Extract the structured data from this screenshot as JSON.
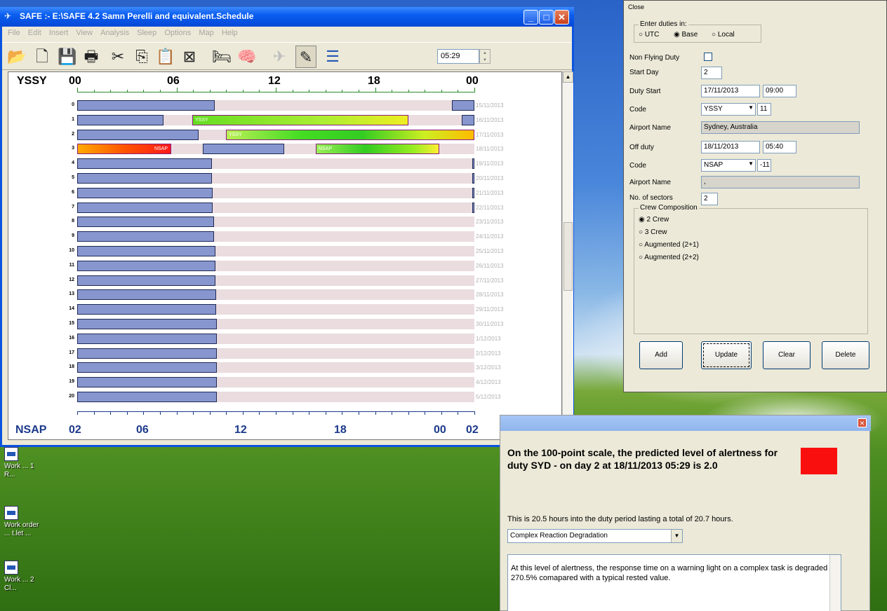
{
  "main_window": {
    "title": "SAFE :- E:\\SAFE 4.2 Samn Perelli and equivalent.Schedule",
    "menu": [
      "File",
      "Edit",
      "Insert",
      "View",
      "Analysis",
      "Sleep",
      "Options",
      "Map",
      "Help"
    ],
    "time_value": "05:29"
  },
  "schedule": {
    "top_station": "YSSY",
    "bottom_station": "NSAP",
    "top_ticks": [
      "00",
      "06",
      "12",
      "18",
      "00"
    ],
    "bottom_ticks": [
      "02",
      "06",
      "12",
      "18",
      "00",
      "02"
    ],
    "rows": [
      {
        "n": "0",
        "date": "15/11/2013"
      },
      {
        "n": "1",
        "date": "16/11/2013"
      },
      {
        "n": "2",
        "date": "17/11/2013"
      },
      {
        "n": "3",
        "date": "18/11/2013"
      },
      {
        "n": "4",
        "date": "19/11/2013"
      },
      {
        "n": "5",
        "date": "20/11/2013"
      },
      {
        "n": "6",
        "date": "21/11/2013"
      },
      {
        "n": "7",
        "date": "22/11/2013"
      },
      {
        "n": "8",
        "date": "23/11/2013"
      },
      {
        "n": "9",
        "date": "24/11/2013"
      },
      {
        "n": "10",
        "date": "25/11/2013"
      },
      {
        "n": "11",
        "date": "26/11/2013"
      },
      {
        "n": "12",
        "date": "27/11/2013"
      },
      {
        "n": "13",
        "date": "28/11/2013"
      },
      {
        "n": "14",
        "date": "29/11/2013"
      },
      {
        "n": "15",
        "date": "30/11/2013"
      },
      {
        "n": "16",
        "date": "1/12/2013"
      },
      {
        "n": "17",
        "date": "2/12/2013"
      },
      {
        "n": "18",
        "date": "3/12/2013"
      },
      {
        "n": "19",
        "date": "4/12/2013"
      },
      {
        "n": "20",
        "date": "5/12/2013"
      }
    ],
    "flight_labels": {
      "yssy": "YSSY",
      "nsap": "NSAP"
    }
  },
  "duty_dialog": {
    "close_label": "Close",
    "enter_duties_label": "Enter duties in:",
    "radio_utc": "UTC",
    "radio_base": "Base",
    "radio_local": "Local",
    "non_flying_label": "Non Flying Duty",
    "start_day_label": "Start Day",
    "start_day": "2",
    "duty_start_label": "Duty Start",
    "duty_start_date": "17/11/2013",
    "duty_start_time": "09:00",
    "code_label": "Code",
    "code1": "YSSY",
    "code1_offset": "11",
    "airport_name_label": "Airport Name",
    "airport1": "Sydney, Australia",
    "off_duty_label": "Off duty",
    "off_duty_date": "18/11/2013",
    "off_duty_time": "05:40",
    "code2": "NSAP",
    "code2_offset": "-11",
    "airport2": ",",
    "sectors_label": "No. of sectors",
    "sectors": "2",
    "crew_group_label": "Crew Composition",
    "crew_options": [
      "2 Crew",
      "3 Crew",
      "Augmented (2+1)",
      "Augmented (2+2)"
    ],
    "btn_add": "Add",
    "btn_update": "Update",
    "btn_clear": "Clear",
    "btn_delete": "Delete"
  },
  "alert_window": {
    "heading": "On the 100-point scale, the predicted level of alertness for duty SYD -  on day 2 at 18/11/2013 05:29 is 2.0",
    "duty_line": "This is 20.5 hours into the duty period lasting a total of 20.7 hours.",
    "selector": "Complex Reaction Degradation",
    "body": "At this level of alertness, the response time on a warning light on a complex task is degraded by 270.5% comapared with a typical rested value.",
    "indicator_color": "#fa0f0f"
  },
  "desktop": {
    "icons": [
      "Work ... 1 R...",
      "Work order ... t.let ...",
      "Work ... 2 Cl..."
    ]
  }
}
